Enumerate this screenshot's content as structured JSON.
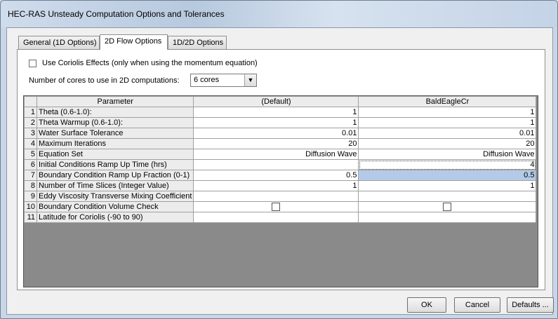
{
  "window": {
    "title": "HEC-RAS Unsteady Computation Options and Tolerances"
  },
  "tabs": [
    {
      "label": "General (1D Options)"
    },
    {
      "label": "2D Flow Options"
    },
    {
      "label": "1D/2D Options"
    }
  ],
  "options": {
    "coriolis_label": "Use Coriolis Effects (only when using the momentum equation)",
    "coriolis_checked": false,
    "cores_label": "Number of cores to use in 2D computations:",
    "cores_value": "6 cores"
  },
  "table": {
    "headers": [
      "Parameter",
      "(Default)",
      "BaldEagleCr"
    ],
    "rows": [
      {
        "num": "1",
        "param": "Theta  (0.6-1.0):",
        "default": "1",
        "area": "1"
      },
      {
        "num": "2",
        "param": "Theta Warmup  (0.6-1.0):",
        "default": "1",
        "area": "1"
      },
      {
        "num": "3",
        "param": "Water Surface Tolerance",
        "default": "0.01",
        "area": "0.01"
      },
      {
        "num": "4",
        "param": "Maximum Iterations",
        "default": "20",
        "area": "20"
      },
      {
        "num": "5",
        "param": "Equation Set",
        "default": "Diffusion Wave",
        "area": "Diffusion Wave"
      },
      {
        "num": "6",
        "param": "Initial Conditions Ramp Up Time (hrs)",
        "default": "",
        "area": "4"
      },
      {
        "num": "7",
        "param": "Boundary Condition Ramp Up Fraction (0-1)",
        "default": "0.5",
        "area": "0.5"
      },
      {
        "num": "8",
        "param": "Number of Time Slices (Integer Value)",
        "default": "1",
        "area": "1"
      },
      {
        "num": "9",
        "param": "Eddy Viscosity Transverse Mixing Coefficient",
        "default": "",
        "area": ""
      },
      {
        "num": "10",
        "param": "Boundary Condition Volume Check",
        "default": "",
        "area": ""
      },
      {
        "num": "11",
        "param": "Latitude for Coriolis (-90 to 90)",
        "default": "",
        "area": ""
      }
    ]
  },
  "buttons": {
    "ok": "OK",
    "cancel": "Cancel",
    "defaults": "Defaults ..."
  }
}
